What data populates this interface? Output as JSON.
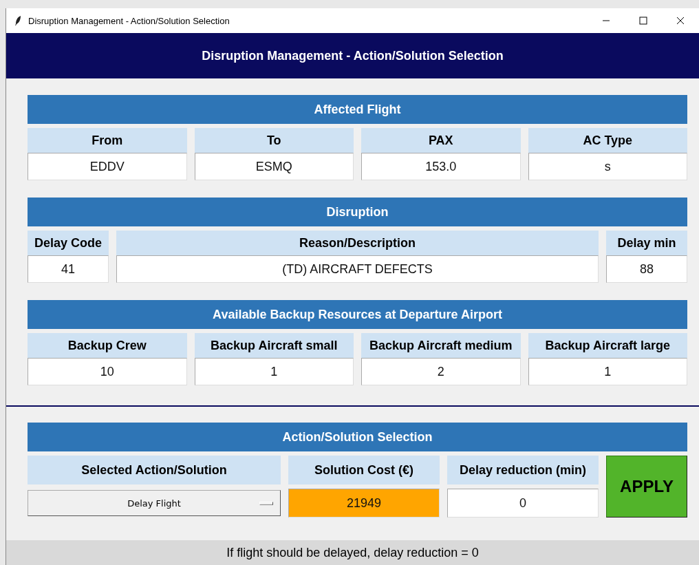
{
  "window": {
    "title": "Disruption Management - Action/Solution Selection"
  },
  "header": {
    "title": "Disruption Management - Action/Solution Selection"
  },
  "sections": [
    {
      "title": "Affected Flight",
      "columns": [
        {
          "header": "From",
          "value": "EDDV"
        },
        {
          "header": "To",
          "value": "ESMQ"
        },
        {
          "header": "PAX",
          "value": "153.0"
        },
        {
          "header": "AC Type",
          "value": "s"
        }
      ]
    },
    {
      "title": "Disruption",
      "columns": [
        {
          "header": "Delay Code",
          "value": "41"
        },
        {
          "header": "Reason/Description",
          "value": "(TD) AIRCRAFT DEFECTS"
        },
        {
          "header": "Delay min",
          "value": "88"
        }
      ]
    },
    {
      "title": "Available Backup Resources at Departure Airport",
      "columns": [
        {
          "header": "Backup Crew",
          "value": "10"
        },
        {
          "header": "Backup Aircraft small",
          "value": "1"
        },
        {
          "header": "Backup Aircraft medium",
          "value": "2"
        },
        {
          "header": "Backup Aircraft large",
          "value": "1"
        }
      ]
    }
  ],
  "action": {
    "title": "Action/Solution Selection",
    "selection_header": "Selected Action/Solution",
    "selection_value": "Delay Flight",
    "cost_header": "Solution Cost (€)",
    "cost_value": "21949",
    "reduction_header": "Delay reduction (min)",
    "reduction_value": "0",
    "apply_label": "APPLY"
  },
  "status_bar": {
    "text": "If flight should be delayed, delay reduction = 0"
  }
}
